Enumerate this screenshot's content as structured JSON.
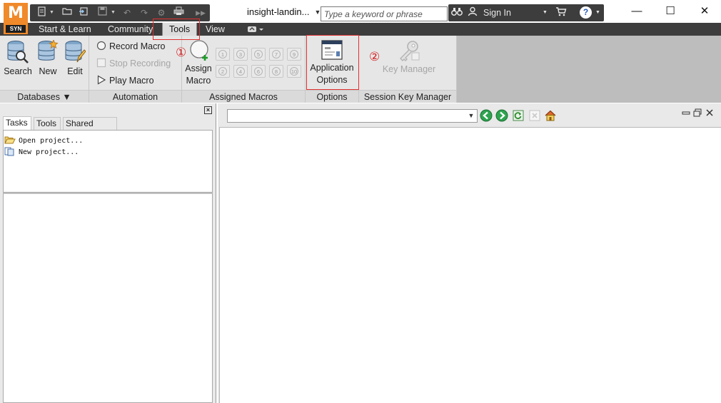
{
  "title_bar": {
    "document_title": "insight-landin...",
    "search_placeholder": "Type a keyword or phrase",
    "sign_in_label": "Sign In",
    "logo_letter": "M",
    "logo_sub": "SYN",
    "help_glyph": "?",
    "icons": [
      "new-project-icon",
      "open-icon",
      "import-icon",
      "save-icon",
      "undo-icon",
      "redo-icon",
      "settings-icon",
      "print-icon",
      "more-icon",
      "binoculars-icon",
      "user-icon",
      "cart-icon",
      "help-icon"
    ]
  },
  "window_controls": {
    "minimize": "—",
    "maximize": "☐",
    "close": "✕"
  },
  "ribbon_tabs": [
    {
      "label": "Start & Learn",
      "active": false
    },
    {
      "label": "Community",
      "active": false
    },
    {
      "label": "Tools",
      "active": true
    },
    {
      "label": "View",
      "active": false
    }
  ],
  "ribbon": {
    "databases": {
      "label": "Databases ▼",
      "buttons": [
        {
          "label": "Search",
          "icon": "database-search-icon"
        },
        {
          "label": "New",
          "icon": "database-new-icon"
        },
        {
          "label": "Edit",
          "icon": "database-edit-icon"
        }
      ]
    },
    "automation": {
      "label": "Automation",
      "record": "Record Macro",
      "stop": "Stop Recording",
      "play": "Play Macro"
    },
    "assigned_macros": {
      "label": "Assigned Macros",
      "assign_line1": "Assign",
      "assign_line2": "Macro",
      "slots_row1": [
        "1",
        "3",
        "5",
        "7",
        "9"
      ],
      "slots_row2": [
        "2",
        "4",
        "6",
        "8",
        "10"
      ]
    },
    "options": {
      "label": "Options",
      "line1": "Application",
      "line2": "Options"
    },
    "session_key_manager": {
      "label": "Session Key Manager",
      "button": "Key Manager"
    }
  },
  "annotations": {
    "callout_1": "①",
    "callout_2": "②"
  },
  "left_panel": {
    "close_glyph": "×",
    "tabs": [
      {
        "label": "Tasks",
        "active": true
      },
      {
        "label": "Tools",
        "active": false
      },
      {
        "label": "Shared Views",
        "active": false
      }
    ],
    "tasks": [
      "Open project...",
      "New project..."
    ]
  },
  "colors": {
    "logo_orange": "#f0892a",
    "dark_chrome": "#3d3d3d",
    "ribbon_bg": "#e6e6e6",
    "annotation_red": "#e03030"
  }
}
